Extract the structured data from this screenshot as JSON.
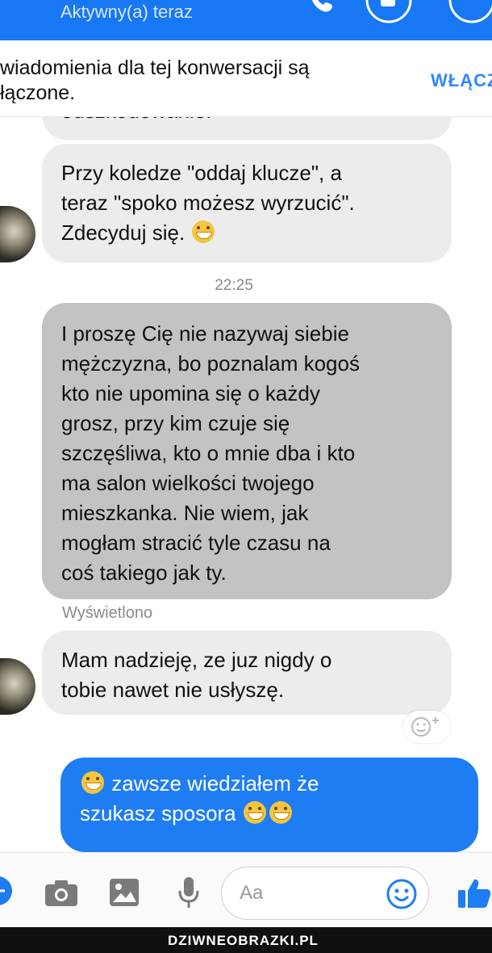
{
  "header": {
    "status": "Aktywny(a) teraz"
  },
  "banner": {
    "lines": [
      "wiadomienia dla tej konwersacji są",
      "łączone."
    ],
    "action": "WŁĄCZ"
  },
  "messages": {
    "partial": "odszkodowanie.",
    "m1": {
      "lines": [
        "Przy koledze \"oddaj klucze\", a",
        "teraz \"spoko możesz wyrzucić\".",
        "Zdecyduj się."
      ],
      "emoji": "grinning-face-icon"
    },
    "time": "22:25",
    "m2": {
      "lines": [
        "I proszę Cię nie nazywaj siebie",
        "mężczyzna, bo poznalam kogoś",
        "kto nie upomina się o każdy",
        "grosz, przy kim czuje się",
        "szczęśliwa, kto o mnie dba i kto",
        "ma salon wielkości twojego",
        "mieszkanka. Nie wiem, jak",
        "mogłam stracić tyle czasu na",
        "coś takiego jak ty."
      ]
    },
    "seen": "Wyświetlono",
    "m3": {
      "lines": [
        "Mam nadzieję, ze juz nigdy o",
        "tobie nawet nie usłyszę."
      ]
    },
    "m4": {
      "lines": [
        "zawsze wiedziałem  że",
        "szukasz sposora"
      ],
      "emoji": "laughing-face-icon"
    }
  },
  "composer": {
    "placeholder": "Aa"
  },
  "footer": {
    "logo": "DZIWNEOBRAZKI.PL"
  },
  "colors": {
    "accent": "#1877f2",
    "outgoing": "#1f7df4",
    "incoming": "#ececec",
    "highlight": "#c3c3c3"
  }
}
